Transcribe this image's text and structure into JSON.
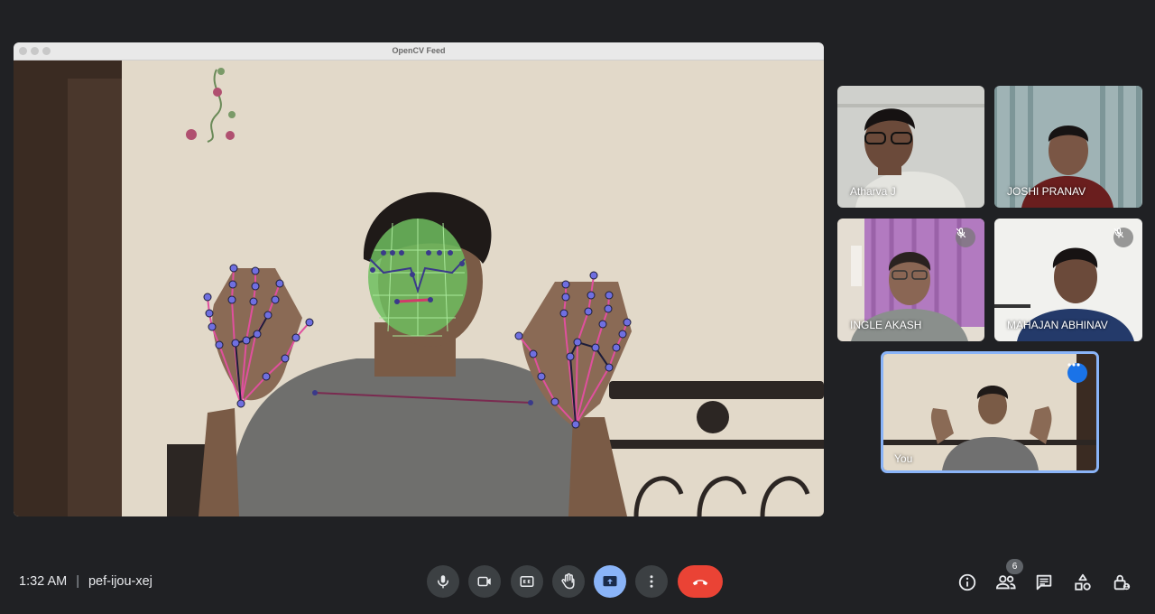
{
  "shared_window": {
    "title": "OpenCV Feed"
  },
  "participants": [
    {
      "name": "Atharva J",
      "muted": false
    },
    {
      "name": "JOSHI PRANAV",
      "muted": false
    },
    {
      "name": "INGLE AKASH",
      "muted": true
    },
    {
      "name": "MAHAJAN ABHINAV",
      "muted": true
    }
  ],
  "self_tile": {
    "name": "You"
  },
  "meeting": {
    "time": "1:32 AM",
    "separator": "|",
    "code": "pef-ijou-xej"
  },
  "controls": [
    {
      "icon": "microphone-icon"
    },
    {
      "icon": "camera-icon"
    },
    {
      "icon": "captions-icon"
    },
    {
      "icon": "raise-hand-icon"
    },
    {
      "icon": "present-screen-icon",
      "active": true
    },
    {
      "icon": "more-options-icon"
    },
    {
      "icon": "end-call-icon"
    }
  ],
  "right_controls": [
    {
      "icon": "info-icon"
    },
    {
      "icon": "people-icon",
      "badge": "6"
    },
    {
      "icon": "chat-icon"
    },
    {
      "icon": "activities-icon"
    },
    {
      "icon": "host-controls-icon"
    }
  ],
  "colors": {
    "background": "#202124",
    "accent": "#8ab4f8",
    "end_call": "#ea4335",
    "face_mesh": "#7bd67b",
    "hand_landmarks": "#e0509e"
  }
}
